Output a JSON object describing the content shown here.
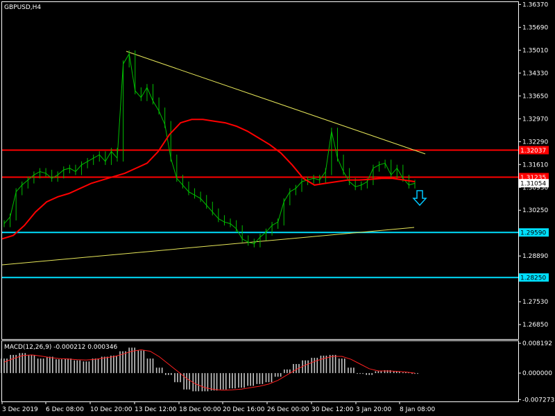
{
  "symbol_label": "GBPUSD,H4",
  "colors": {
    "background": "#000000",
    "candle": "#00c000",
    "ma": "#ff0000",
    "trendline": "#e8e85a",
    "resistance": "#ff0000",
    "support": "#00e0ff",
    "macd_hist": "#c8c8c8",
    "macd_signal": "#ff2020",
    "frame": "#ffffff"
  },
  "price_axis": {
    "ticks": [
      "1.36370",
      "1.35690",
      "1.35010",
      "1.34330",
      "1.33650",
      "1.32970",
      "1.32290",
      "1.31610",
      "1.30930",
      "1.30250",
      "1.28890",
      "1.27530",
      "1.26850"
    ],
    "ylim": [
      1.2642,
      1.3644
    ]
  },
  "hlines": [
    {
      "price": 1.32037,
      "label": "1.32037",
      "kind": "resistance"
    },
    {
      "price": 1.31235,
      "label": "1.31235",
      "kind": "resistance"
    },
    {
      "price": 1.2959,
      "label": "1.29590",
      "kind": "support"
    },
    {
      "price": 1.2825,
      "label": "1.28250",
      "kind": "support"
    }
  ],
  "current_price": {
    "price": 1.31054,
    "label": "1.31054"
  },
  "macd": {
    "label": "MACD(12,26,9) -0.000212 0.000346",
    "ticks": [
      "0.008192",
      "0.000000",
      "-0.007273"
    ],
    "ylim": [
      -0.0076,
      0.0086
    ]
  },
  "time_axis": {
    "labels": [
      "3 Dec 2019",
      "6 Dec 08:00",
      "10 Dec 20:00",
      "13 Dec 12:00",
      "18 Dec 00:00",
      "20 Dec 16:00",
      "26 Dec 00:00",
      "30 Dec 12:00",
      "3 Jan 20:00",
      "8 Jan 08:00"
    ]
  },
  "signal": {
    "icon": "down-arrow-icon",
    "direction": "down"
  },
  "chart_data": {
    "type": "line",
    "title": "GBPUSD,H4",
    "series": [
      {
        "name": "price",
        "values": [
          1.2985,
          1.3005,
          1.308,
          1.31,
          1.3115,
          1.313,
          1.314,
          1.3135,
          1.312,
          1.313,
          1.3145,
          1.315,
          1.314,
          1.316,
          1.317,
          1.318,
          1.319,
          1.317,
          1.32,
          1.318,
          1.346,
          1.349,
          1.338,
          1.336,
          1.339,
          1.335,
          1.332,
          1.328,
          1.318,
          1.312,
          1.31,
          1.308,
          1.307,
          1.306,
          1.304,
          1.302,
          1.3,
          1.299,
          1.2985,
          1.297,
          1.294,
          1.293,
          1.2925,
          1.2945,
          1.296,
          1.298,
          1.299,
          1.305,
          1.308,
          1.309,
          1.311,
          1.3115,
          1.312,
          1.3115,
          1.314,
          1.326,
          1.318,
          1.314,
          1.311,
          1.3095,
          1.31,
          1.311,
          1.315,
          1.316,
          1.3165,
          1.313,
          1.315,
          1.312,
          1.31,
          1.3105
        ]
      },
      {
        "name": "ma",
        "values": [
          1.294,
          1.295,
          1.298,
          1.302,
          1.305,
          1.3065,
          1.3075,
          1.309,
          1.3105,
          1.3115,
          1.3125,
          1.3135,
          1.315,
          1.3165,
          1.32,
          1.325,
          1.3285,
          1.3295,
          1.3295,
          1.329,
          1.3285,
          1.3275,
          1.326,
          1.324,
          1.322,
          1.3195,
          1.316,
          1.312,
          1.31,
          1.3105,
          1.311,
          1.3115,
          1.3115,
          1.3117,
          1.312,
          1.312,
          1.3115,
          1.311
        ]
      }
    ],
    "macd_histogram": [
      0.004,
      0.005,
      0.0055,
      0.005,
      0.004,
      0.0045,
      0.0038,
      0.004,
      0.0035,
      0.0032,
      0.004,
      0.0045,
      0.0048,
      0.006,
      0.007,
      0.0062,
      0.004,
      0.0015,
      -0.0005,
      -0.0025,
      -0.0045,
      -0.005,
      -0.005,
      -0.0048,
      -0.0045,
      -0.0042,
      -0.004,
      -0.0035,
      -0.003,
      -0.0025,
      -0.001,
      0.001,
      0.0025,
      0.0035,
      0.0042,
      0.0048,
      0.005,
      0.004,
      0.0015,
      -0.0002,
      -0.0005,
      0.0005,
      0.0008,
      0.0005,
      0.0002,
      -0.0002
    ],
    "macd_signal": [
      0.003,
      0.004,
      0.0048,
      0.005,
      0.0047,
      0.0043,
      0.004,
      0.0039,
      0.0037,
      0.0036,
      0.0038,
      0.0042,
      0.0045,
      0.0052,
      0.006,
      0.0064,
      0.006,
      0.0045,
      0.0025,
      0.0005,
      -0.0015,
      -0.003,
      -0.004,
      -0.0045,
      -0.0047,
      -0.0046,
      -0.0044,
      -0.004,
      -0.0036,
      -0.003,
      -0.002,
      -0.0005,
      0.001,
      0.0022,
      0.0032,
      0.004,
      0.0046,
      0.0046,
      0.0038,
      0.0025,
      0.0012,
      0.0006,
      0.0006,
      0.0005,
      0.0003,
      0.0
    ],
    "ylim": [
      1.2642,
      1.3644
    ],
    "xlabel": "",
    "ylabel": ""
  }
}
